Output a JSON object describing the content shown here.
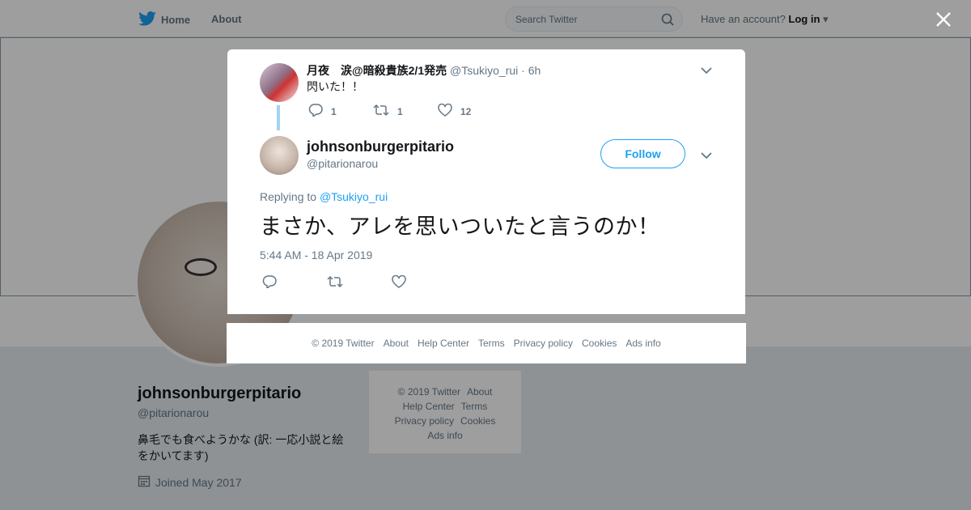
{
  "nav": {
    "home_label": "Home",
    "about_label": "About",
    "search_placeholder": "Search Twitter",
    "have_account": "Have an account?",
    "login_label": "Log in",
    "brand_color": "#1da1f2"
  },
  "profile": {
    "display_name": "johnsonburgerpitario",
    "handle": "@pitarionarou",
    "bio": "鼻毛でも食べようかな (訳: 一応小説と絵をかいてます)",
    "joined": "Joined May 2017"
  },
  "bg_footer": {
    "copyright": "© 2019 Twitter",
    "about": "About",
    "help": "Help Center",
    "terms": "Terms",
    "privacy": "Privacy policy",
    "cookies": "Cookies",
    "ads": "Ads info"
  },
  "parent_tweet": {
    "author_name": "月夜　涙@暗殺貴族2/1発売",
    "author_handle": "@Tsukiyo_rui",
    "time": "· 6h",
    "text": "閃いた！！",
    "replies": "1",
    "retweets": "1",
    "likes": "12"
  },
  "main_tweet": {
    "author_name": "johnsonburgerpitario",
    "author_handle": "@pitarionarou",
    "follow_label": "Follow",
    "replying_prefix": "Replying to",
    "replying_to": "@Tsukiyo_rui",
    "text": "まさか、アレを思いついたと言うのか！",
    "timestamp": "5:44 AM - 18 Apr 2019"
  },
  "modal_footer": {
    "copyright": "© 2019 Twitter",
    "about": "About",
    "help": "Help Center",
    "terms": "Terms",
    "privacy": "Privacy policy",
    "cookies": "Cookies",
    "ads": "Ads info"
  }
}
